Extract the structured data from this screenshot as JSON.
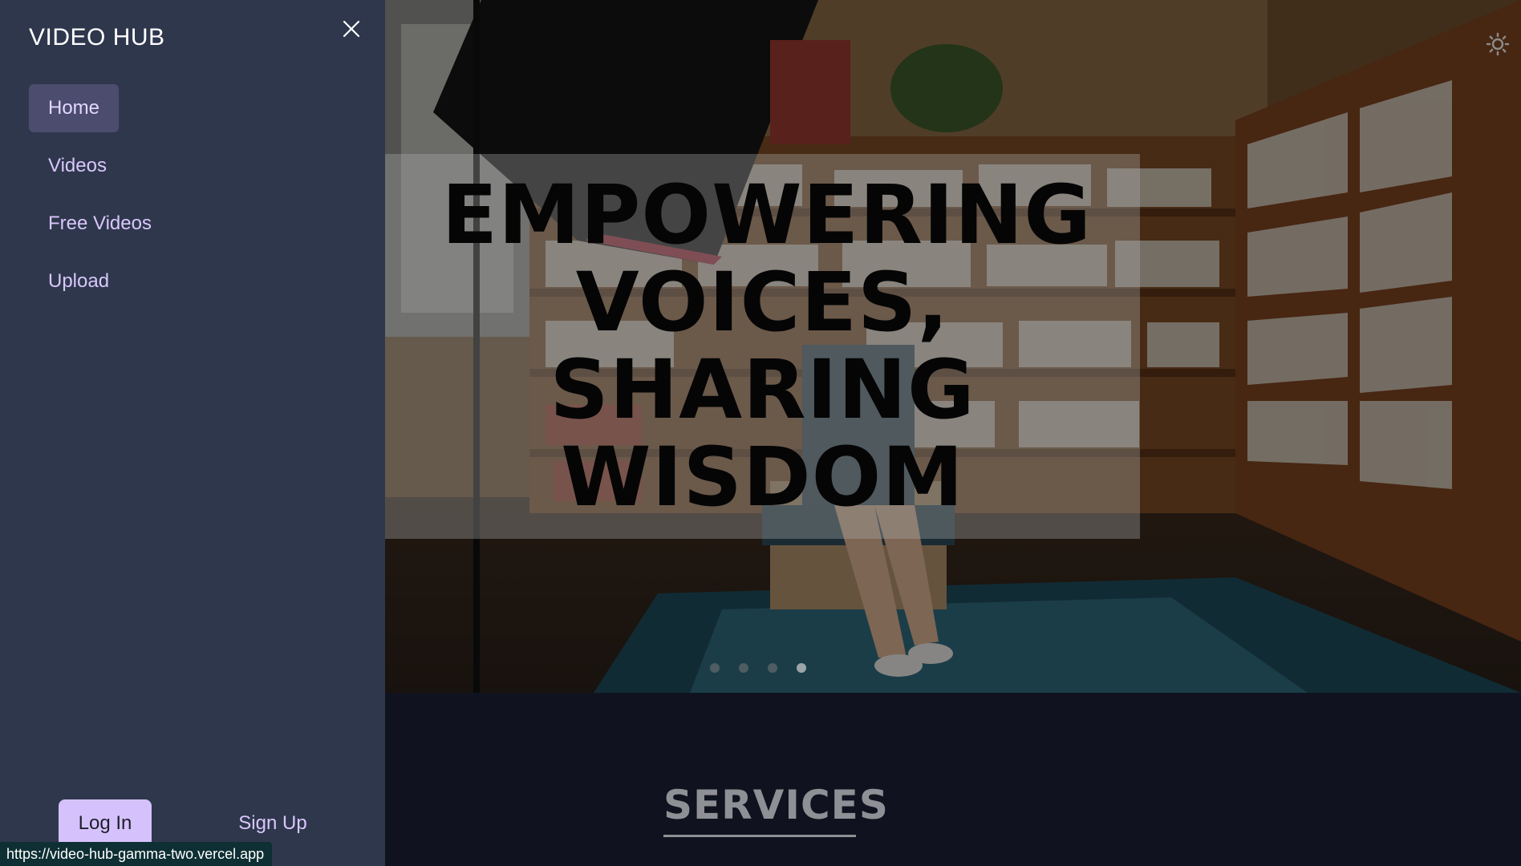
{
  "sidebar": {
    "brand": "VIDEO HUB",
    "close_icon": "close-icon",
    "items": [
      {
        "label": "Home",
        "active": true
      },
      {
        "label": "Videos",
        "active": false
      },
      {
        "label": "Free Videos",
        "active": false
      },
      {
        "label": "Upload",
        "active": false
      }
    ],
    "login_label": "Log In",
    "signup_label": "Sign Up"
  },
  "hero": {
    "title": "EMPOWERING VOICES, SHARING WISDOM",
    "slides_count": 4,
    "active_slide": 4,
    "image_icon": "studio-library-photo"
  },
  "theme_toggle_icon": "sun-icon",
  "services": {
    "title": "SERVICES"
  },
  "status_bar": {
    "url": "https://video-hub-gamma-two.vercel.app"
  },
  "colors": {
    "sidebar_bg": "#2f374d",
    "accent": "#d5c2fc",
    "nav_text": "#d9c7fb",
    "active_bg": "#4b4c6e",
    "page_bg": "#10131f"
  }
}
